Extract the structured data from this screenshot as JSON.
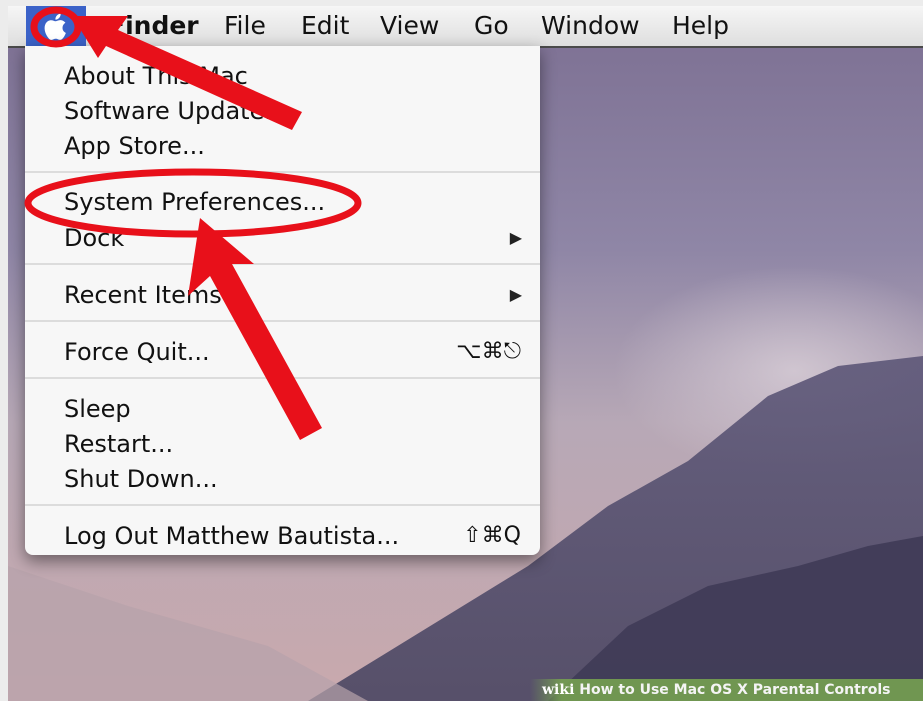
{
  "menubar": {
    "items": [
      "Finder",
      "File",
      "Edit",
      "View",
      "Go",
      "Window",
      "Help"
    ]
  },
  "apple_menu": {
    "items": [
      {
        "label": "About This Mac"
      },
      {
        "label": "Software Update..."
      },
      {
        "label": "App Store..."
      },
      {
        "label": "System Preferences..."
      },
      {
        "label": "Dock",
        "submenu": true
      },
      {
        "label": "Recent Items",
        "submenu": true
      },
      {
        "label": "Force Quit...",
        "shortcut": "⌥⌘⎋"
      },
      {
        "label": "Sleep"
      },
      {
        "label": "Restart..."
      },
      {
        "label": "Shut Down..."
      },
      {
        "label": "Log Out Matthew Bautista...",
        "shortcut": "⇧⌘Q"
      }
    ]
  },
  "annotation": {
    "color": "#e8101a",
    "arrows": 2,
    "circled_items": [
      "apple-menu",
      "System Preferences..."
    ]
  },
  "watermark": {
    "brand": "wiki",
    "text": "How to Use Mac OS X Parental Controls"
  },
  "colors": {
    "menubar_highlight": "#3b62c8",
    "menu_bg": "#f7f7f7"
  }
}
